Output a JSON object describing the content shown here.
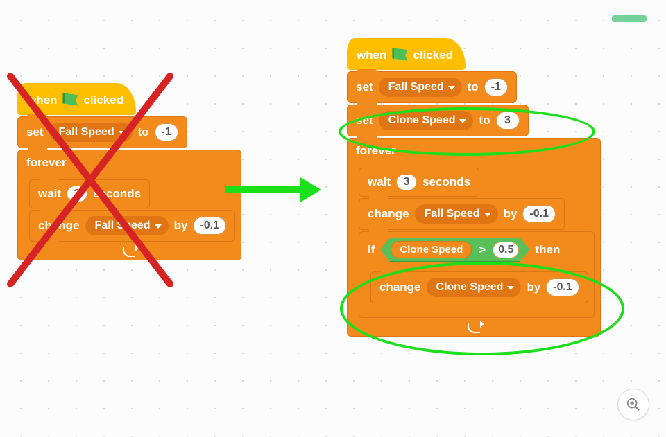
{
  "header": {
    "accent_color": "#77d19a"
  },
  "labels": {
    "when": "when",
    "clicked": "clicked",
    "set": "set",
    "to": "to",
    "forever": "forever",
    "wait": "wait",
    "seconds": "seconds",
    "change": "change",
    "by": "by",
    "if": "if",
    "then": "then",
    "gt": ">"
  },
  "left_script": {
    "hat": {
      "type": "green_flag"
    },
    "set_fall_speed": {
      "var": "Fall Speed",
      "value": "-1"
    },
    "forever": {
      "wait_seconds": "3",
      "change_fall_speed": {
        "var": "Fall Speed",
        "value": "-0.1"
      }
    }
  },
  "right_script": {
    "hat": {
      "type": "green_flag"
    },
    "set_fall_speed": {
      "var": "Fall Speed",
      "value": "-1"
    },
    "set_clone_speed": {
      "var": "Clone Speed",
      "value": "3"
    },
    "forever": {
      "wait_seconds": "3",
      "change_fall_speed": {
        "var": "Fall Speed",
        "value": "-0.1"
      },
      "if_clone_speed_gt": {
        "var": "Clone Speed",
        "threshold": "0.5"
      },
      "change_clone_speed": {
        "var": "Clone Speed",
        "value": "-0.1"
      }
    }
  },
  "annotations": {
    "red_x": true,
    "green_arrow": true,
    "green_circles": 2
  },
  "controls": {
    "zoom_in": "Zoom in"
  }
}
